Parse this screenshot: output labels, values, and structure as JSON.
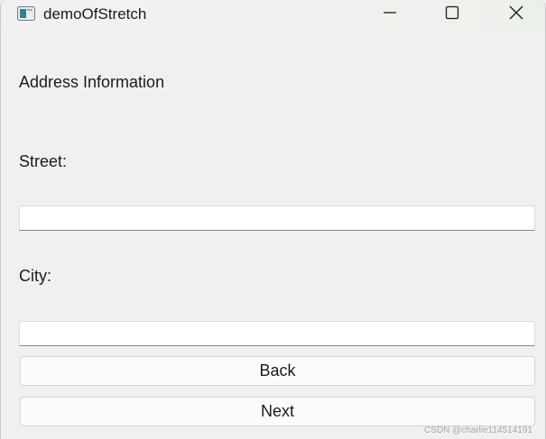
{
  "window": {
    "title": "demoOfStretch"
  },
  "form": {
    "heading": "Address Information",
    "street_label": "Street:",
    "street_value": "",
    "city_label": "City:",
    "city_value": "",
    "back_label": "Back",
    "next_label": "Next"
  },
  "watermark": "CSDN @charlie114514191",
  "colors": {
    "background": "#f0f0f0",
    "field_background": "#ffffff",
    "button_background": "#fbfbfb"
  },
  "icons": [
    "app-window-icon",
    "minimize-icon",
    "maximize-icon",
    "close-icon"
  ]
}
